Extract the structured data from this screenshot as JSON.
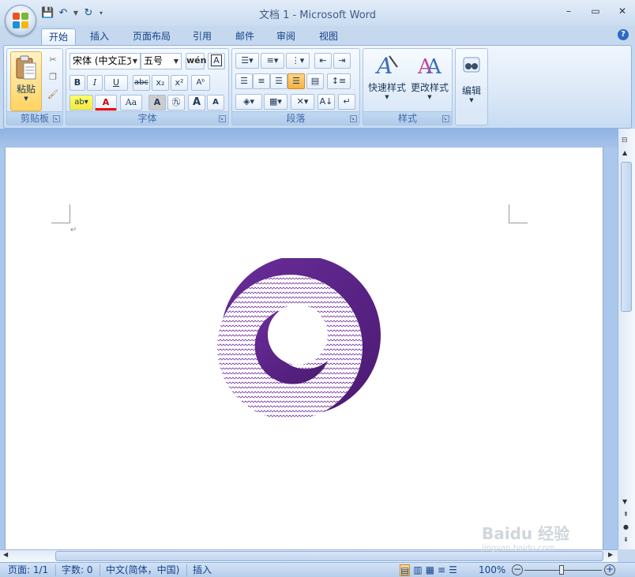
{
  "window": {
    "title": "文档 1 - Microsoft Word",
    "controls": [
      "–",
      "▭",
      "✕"
    ]
  },
  "qat": {
    "save": "💾",
    "undo": "↶",
    "redo": "↻"
  },
  "tabs": [
    "开始",
    "插入",
    "页面布局",
    "引用",
    "邮件",
    "审阅",
    "视图"
  ],
  "ribbon": {
    "clipboard": {
      "label": "剪贴板",
      "paste": "粘贴"
    },
    "font": {
      "label": "字体",
      "font_name": "宋体 (中文正文)",
      "font_size": "五号",
      "bold": "B",
      "italic": "I",
      "underline": "U",
      "strike": "abc",
      "subscript": "x₂",
      "superscript": "x²",
      "font_color": "A",
      "change_case": "Aa",
      "grow": "A",
      "shrink": "A"
    },
    "paragraph": {
      "label": "段落"
    },
    "styles": {
      "label": "样式",
      "quick_styles": "快速样式",
      "change_styles": "更改样式"
    },
    "editing": {
      "label": "编辑"
    }
  },
  "document": {
    "paragraph_mark": "↵"
  },
  "statusbar": {
    "page": "页面: 1/1",
    "words": "字数: 0",
    "language": "中文(简体，中国)",
    "mode": "插入",
    "zoom": "100%"
  },
  "watermark": "Baidu 经验",
  "watermark_sub": "jingyan.baidu.com",
  "colors": {
    "shape_purple": "#5a2185",
    "ribbon_bg": "#dbe8f7",
    "accent": "#15428b"
  }
}
